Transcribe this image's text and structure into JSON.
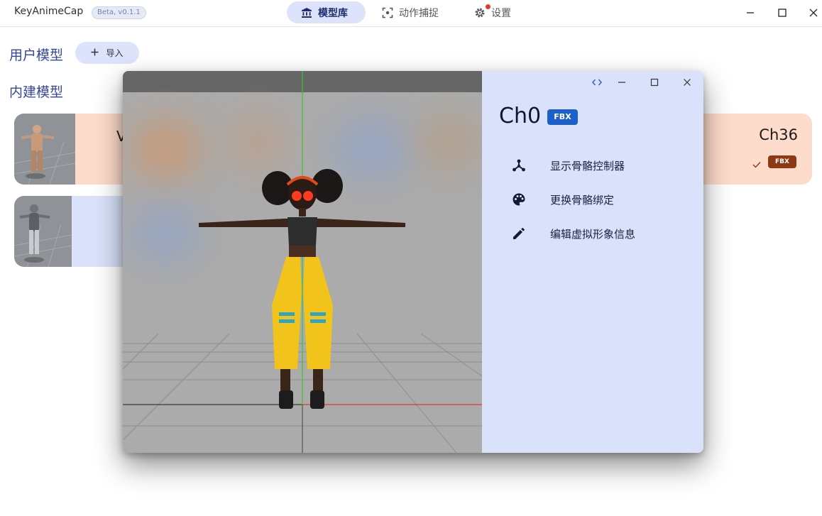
{
  "app": {
    "title": "KeyAnimeCap",
    "version_badge": "Beta, v0.1.1"
  },
  "nav": {
    "tabs": [
      {
        "label": "模型库",
        "icon": "bank-icon",
        "active": true
      },
      {
        "label": "动作捕捉",
        "icon": "capture-icon",
        "active": false
      },
      {
        "label": "设置",
        "icon": "gear-icon",
        "active": false,
        "notification": true
      }
    ]
  },
  "window_controls": [
    "minimize-icon",
    "maximize-icon",
    "close-icon"
  ],
  "main": {
    "user_models_title": "用户模型",
    "import_label": "导入",
    "builtin_models_title": "内建模型",
    "cards": [
      {
        "name": "Ch36",
        "partial_text": "V",
        "format": "FBX",
        "color": "#fedccb",
        "selected": true
      },
      {
        "name": "",
        "partial_text": "",
        "format": "",
        "color": "#dae2fb",
        "selected": false
      }
    ]
  },
  "dialog": {
    "controls": [
      "code-icon",
      "minimize-icon",
      "maximize-icon",
      "close-icon"
    ],
    "model_name": "Ch0",
    "format_badge": "FBX",
    "menu": [
      {
        "label": "显示骨骼控制器",
        "icon": "skeleton-icon"
      },
      {
        "label": "更换骨骼绑定",
        "icon": "palette-icon"
      },
      {
        "label": "编辑虚拟形象信息",
        "icon": "pencil-icon"
      }
    ]
  },
  "colors": {
    "accent": "#35469c",
    "nav_active_bg": "#dde3fb",
    "card_orange": "#fedccb",
    "card_blue": "#dae2fb",
    "fbx_brown": "#8d3a14",
    "fbx_blue": "#1d5fc9"
  }
}
